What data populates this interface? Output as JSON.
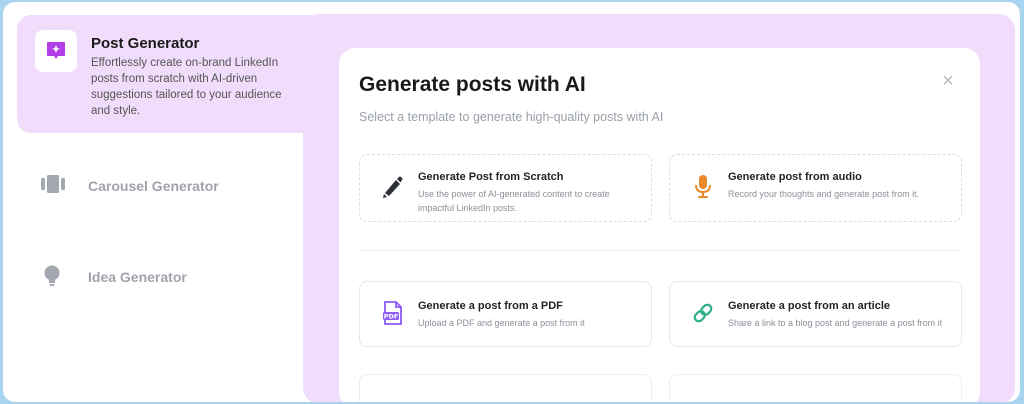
{
  "sidebar": {
    "items": [
      {
        "title": "Post Generator",
        "description": "Effortlessly create on-brand LinkedIn posts from scratch with AI-driven suggestions tailored to your audience and style.",
        "icon": "sparkle-chat-icon",
        "active": true
      },
      {
        "title": "Carousel Generator",
        "icon": "carousel-icon",
        "active": false
      },
      {
        "title": "Idea Generator",
        "icon": "lightbulb-icon",
        "active": false
      }
    ]
  },
  "modal": {
    "title": "Generate posts with AI",
    "subtitle": "Select a template to generate high-quality posts with AI",
    "close_label": "×",
    "cards": [
      {
        "title": "Generate Post from Scratch",
        "description": "Use the power of AI-generated content to create impactful LinkedIn posts.",
        "icon": "pen-icon"
      },
      {
        "title": "Generate post from audio",
        "description": "Record your thoughts and generate post from it.",
        "icon": "microphone-icon"
      },
      {
        "title": "Generate a post from a PDF",
        "description": "Upload a PDF and generate a post from it",
        "icon": "pdf-file-icon"
      },
      {
        "title": "Generate a post from an article",
        "description": "Share a link to a blog post and generate a post from it",
        "icon": "link-icon"
      }
    ]
  },
  "colors": {
    "accent_purple": "#b13ee6",
    "panel": "#f1ddfb",
    "mic_orange": "#e8892b",
    "link_green": "#2fae8a",
    "pdf_purple": "#8b5cf6",
    "page_border": "#a9d4ef"
  }
}
